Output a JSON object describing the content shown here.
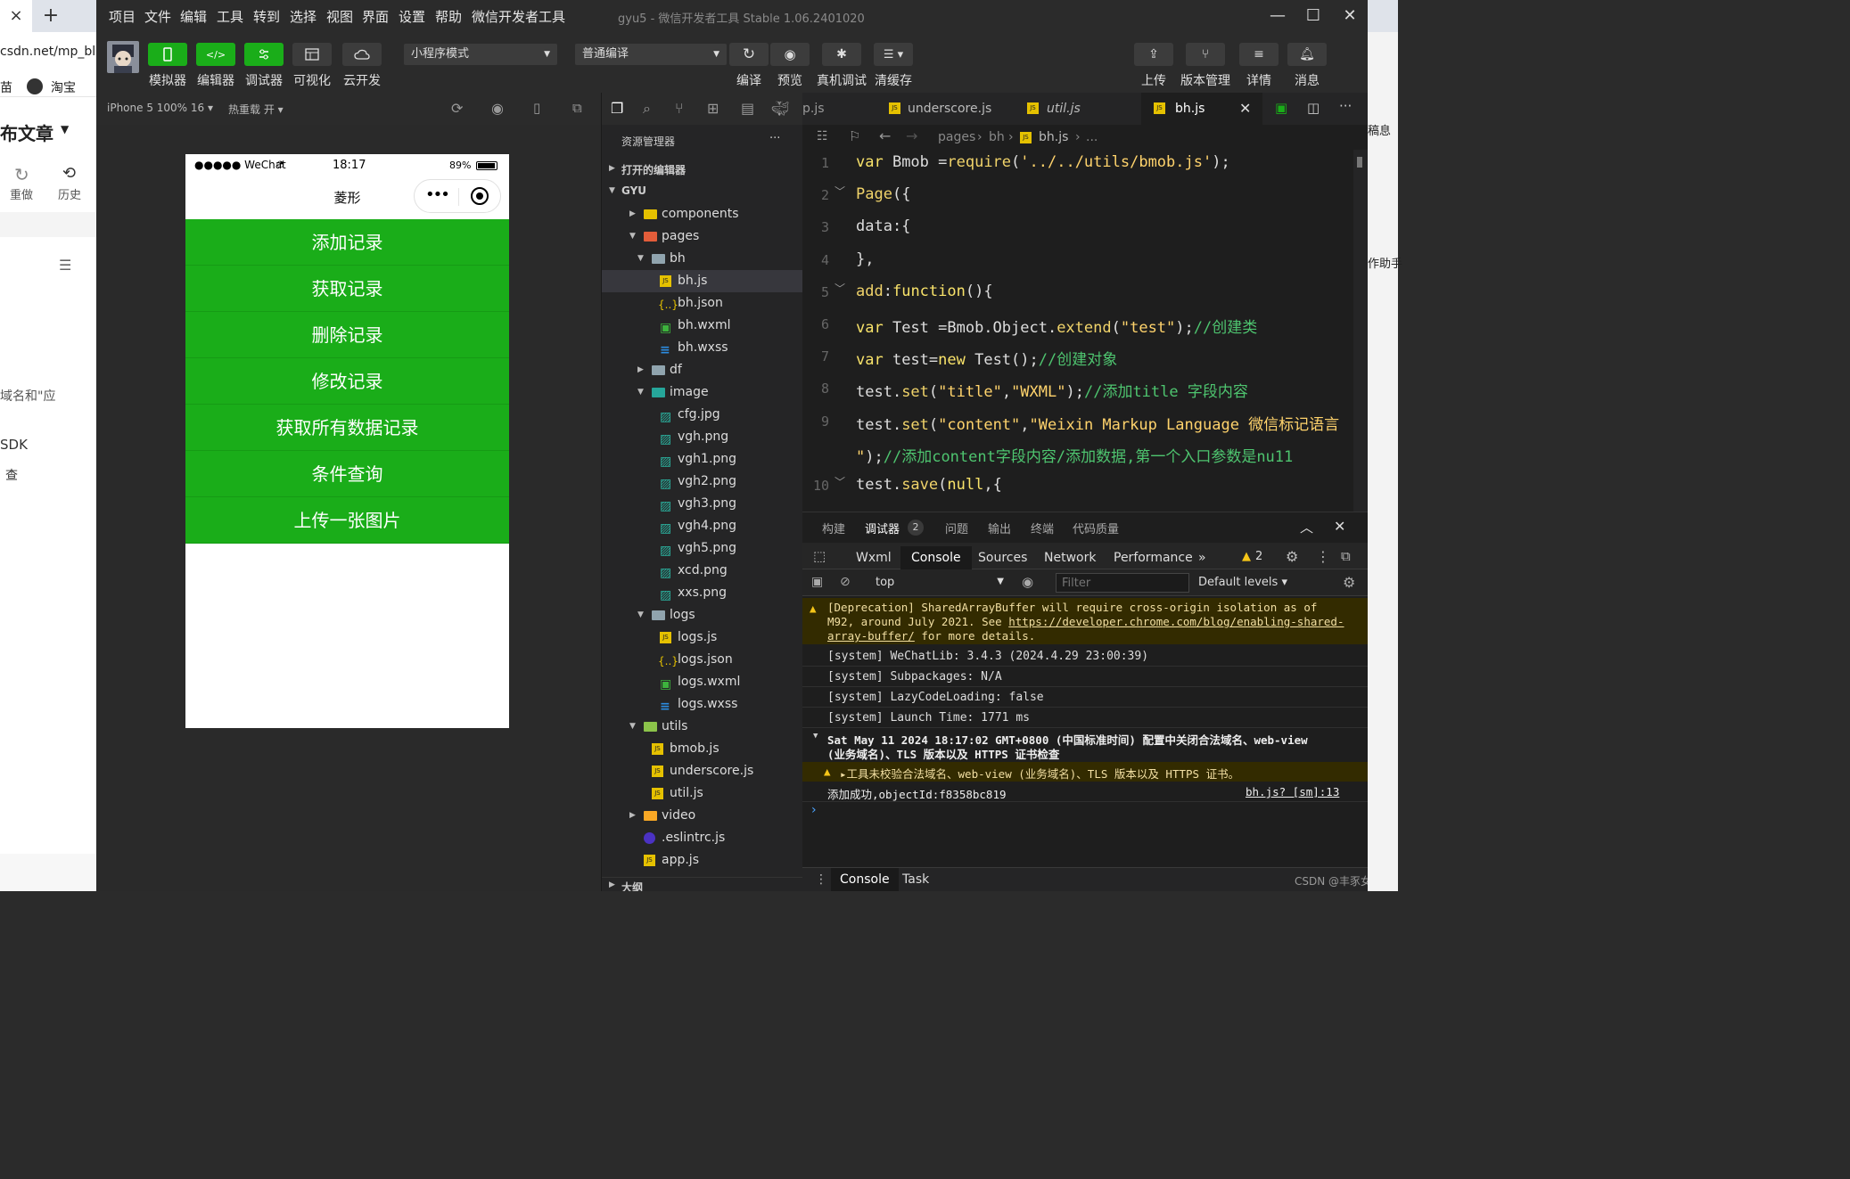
{
  "browser_bg": {
    "tab_close": "×",
    "tab_plus": "+",
    "url": "csdn.net/mp_blog",
    "bookmark1": "苗",
    "bookmark2": "淘宝",
    "publish": "布文章",
    "redo": "重做",
    "history": "历史",
    "domain_text": "域名和\"应",
    "sdk": "SDK",
    "search": "查",
    "right_text1": "稿息",
    "right_text2": "作助手"
  },
  "window": {
    "menu": [
      "项目",
      "文件",
      "编辑",
      "工具",
      "转到",
      "选择",
      "视图",
      "界面",
      "设置",
      "帮助",
      "微信开发者工具"
    ],
    "title": "gyu5 - 微信开发者工具 Stable 1.06.2401020",
    "min": "—",
    "max": "☐",
    "close": "✕"
  },
  "toolbar": {
    "simulator": "模拟器",
    "editor": "编辑器",
    "debugger": "调试器",
    "visual": "可视化",
    "cloud": "云开发",
    "mode": "小程序模式",
    "compile_mode": "普通编译",
    "compile": "编译",
    "preview": "预览",
    "real_debug": "真机调试",
    "clear_cache": "清缓存",
    "upload": "上传",
    "version": "版本管理",
    "details": "详情",
    "messages": "消息"
  },
  "simulator": {
    "device": "iPhone 5 100% 16",
    "hotreload": "热重载 开",
    "status_signal": "●●●●● WeChat",
    "status_time": "18:17",
    "status_battery": "89%",
    "page_title": "菱形",
    "buttons": [
      "添加记录",
      "获取记录",
      "删除记录",
      "修改记录",
      "获取所有数据记录",
      "条件查询",
      "上传一张图片"
    ]
  },
  "explorer": {
    "title": "资源管理器",
    "more": "···",
    "open_editors": "打开的编辑器",
    "root": "GYU",
    "outline": "大纲",
    "items": [
      {
        "label": "components",
        "depth": 1,
        "type": "folder",
        "open": false
      },
      {
        "label": "pages",
        "depth": 1,
        "type": "folder",
        "open": true
      },
      {
        "label": "bh",
        "depth": 2,
        "type": "folder",
        "open": true
      },
      {
        "label": "bh.js",
        "depth": 3,
        "type": "js",
        "selected": true
      },
      {
        "label": "bh.json",
        "depth": 3,
        "type": "json"
      },
      {
        "label": "bh.wxml",
        "depth": 3,
        "type": "wxml"
      },
      {
        "label": "bh.wxss",
        "depth": 3,
        "type": "wxss"
      },
      {
        "label": "df",
        "depth": 2,
        "type": "folder",
        "open": false
      },
      {
        "label": "image",
        "depth": 2,
        "type": "folder",
        "open": true
      },
      {
        "label": "cfg.jpg",
        "depth": 3,
        "type": "img"
      },
      {
        "label": "vgh.png",
        "depth": 3,
        "type": "img"
      },
      {
        "label": "vgh1.png",
        "depth": 3,
        "type": "img"
      },
      {
        "label": "vgh2.png",
        "depth": 3,
        "type": "img"
      },
      {
        "label": "vgh3.png",
        "depth": 3,
        "type": "img"
      },
      {
        "label": "vgh4.png",
        "depth": 3,
        "type": "img"
      },
      {
        "label": "vgh5.png",
        "depth": 3,
        "type": "img"
      },
      {
        "label": "xcd.png",
        "depth": 3,
        "type": "img"
      },
      {
        "label": "xxs.png",
        "depth": 3,
        "type": "img"
      },
      {
        "label": "logs",
        "depth": 2,
        "type": "folder",
        "open": true
      },
      {
        "label": "logs.js",
        "depth": 3,
        "type": "js"
      },
      {
        "label": "logs.json",
        "depth": 3,
        "type": "json"
      },
      {
        "label": "logs.wxml",
        "depth": 3,
        "type": "wxml"
      },
      {
        "label": "logs.wxss",
        "depth": 3,
        "type": "wxss"
      },
      {
        "label": "utils",
        "depth": 1,
        "type": "folder",
        "open": true
      },
      {
        "label": "bmob.js",
        "depth": 2,
        "type": "js"
      },
      {
        "label": "underscore.js",
        "depth": 2,
        "type": "js"
      },
      {
        "label": "util.js",
        "depth": 2,
        "type": "js"
      },
      {
        "label": "video",
        "depth": 1,
        "type": "folder",
        "open": false
      },
      {
        "label": ".eslintrc.js",
        "depth": 1,
        "type": "eslint"
      },
      {
        "label": "app.js",
        "depth": 1,
        "type": "js"
      }
    ]
  },
  "editor": {
    "tabs": [
      "p.js",
      "underscore.js",
      "util.js",
      "bh.js"
    ],
    "active_tab": "bh.js",
    "breadcrumb": [
      "pages",
      "bh",
      "bh.js",
      "..."
    ],
    "lines": [
      {
        "n": "1",
        "code": [
          [
            "kw",
            "var "
          ],
          [
            "pl",
            "Bmob ="
          ],
          [
            "fn",
            "require"
          ],
          [
            "pl",
            "("
          ],
          [
            "st",
            "'../../utils/bmob.js'"
          ],
          [
            "pl",
            ");"
          ]
        ]
      },
      {
        "n": "2",
        "code": [
          [
            "fn",
            "Page"
          ],
          [
            "pl",
            "({"
          ]
        ]
      },
      {
        "n": "3",
        "code": [
          [
            "pl",
            "data:{"
          ]
        ]
      },
      {
        "n": "4",
        "code": [
          [
            "pl",
            "},"
          ]
        ]
      },
      {
        "n": "5",
        "code": [
          [
            "fn",
            "add"
          ],
          [
            "pl",
            ":"
          ],
          [
            "kw",
            "function"
          ],
          [
            "pl",
            "(){"
          ]
        ]
      },
      {
        "n": "6",
        "code": [
          [
            "kw",
            "var "
          ],
          [
            "pl",
            "Test =Bmob.Object."
          ],
          [
            "fn",
            "extend"
          ],
          [
            "pl",
            "("
          ],
          [
            "st",
            "\"test\""
          ],
          [
            "pl",
            ");"
          ],
          [
            "cm",
            "//创建类"
          ]
        ]
      },
      {
        "n": "7",
        "code": [
          [
            "kw",
            "var "
          ],
          [
            "pl",
            "test="
          ],
          [
            "kw",
            "new "
          ],
          [
            "pl",
            "Test();"
          ],
          [
            "cm",
            "//创建对象"
          ]
        ]
      },
      {
        "n": "8",
        "code": [
          [
            "pl",
            "test."
          ],
          [
            "fn",
            "set"
          ],
          [
            "pl",
            "("
          ],
          [
            "st",
            "\"title\""
          ],
          [
            "pl",
            ","
          ],
          [
            "st",
            "\"WXML\""
          ],
          [
            "pl",
            ");"
          ],
          [
            "cm",
            "//添加title 字段内容"
          ]
        ]
      },
      {
        "n": "9",
        "code": [
          [
            "pl",
            "test."
          ],
          [
            "fn",
            "set"
          ],
          [
            "pl",
            "("
          ],
          [
            "st",
            "\"content\""
          ],
          [
            "pl",
            ","
          ],
          [
            "st",
            "\"Weixin Markup Language 微信标记语言"
          ]
        ]
      },
      {
        "n": "",
        "code": [
          [
            "st",
            "\""
          ],
          [
            "pl",
            ");"
          ],
          [
            "cm",
            "//添加content字段内容/添加数据,第一个入口参数是nu11"
          ]
        ]
      },
      {
        "n": "10",
        "code": [
          [
            "pl",
            "test."
          ],
          [
            "fn",
            "save"
          ],
          [
            "pl",
            "("
          ],
          [
            "kw",
            "null"
          ],
          [
            "pl",
            ",{"
          ]
        ]
      }
    ]
  },
  "console": {
    "panel_tabs": [
      "构建",
      "调试器",
      "问题",
      "输出",
      "终端",
      "代码质量"
    ],
    "debugger_badge": "2",
    "devtools_tabs": [
      "Wxml",
      "Console",
      "Sources",
      "Network",
      "Performance"
    ],
    "more_tabs": "»",
    "warn_count": "2",
    "context": "top",
    "filter_placeholder": "Filter",
    "levels": "Default levels",
    "messages": {
      "deprecation_1": "[Deprecation] SharedArrayBuffer will require cross-origin isolation as of",
      "deprecation_2a": "M92, around July 2021. See ",
      "deprecation_link": "https://developer.chrome.com/blog/enabling-shared-",
      "deprecation_link2": "array-buffer/",
      "deprecation_3": " for more details.",
      "sys1": "[system] WeChatLib: 3.4.3 (2024.4.29 23:00:39)",
      "sys2": "[system] Subpackages: N/A",
      "sys3": "[system] LazyCodeLoading: false",
      "sys4": "[system] Launch Time: 1771 ms",
      "group_1": "Sat May 11 2024 18:17:02 GMT+0800 (中国标准时间) 配置中关闭合法域名、web-view",
      "group_2": "(业务域名)、TLS 版本以及 HTTPS 证书检查",
      "warn2": "▸工具未校验合法域名、web-view (业务域名)、TLS 版本以及 HTTPS 证书。",
      "success": "添加成功,objectId:f8358bc819",
      "success_src": "bh.js? [sm]:13",
      "prompt": "›"
    },
    "bottom_tabs": [
      "Console",
      "Task"
    ],
    "watermark": "CSDN @丰豕女女"
  },
  "colors": {
    "green": "#1aad19",
    "accent": "#f9e36a"
  }
}
